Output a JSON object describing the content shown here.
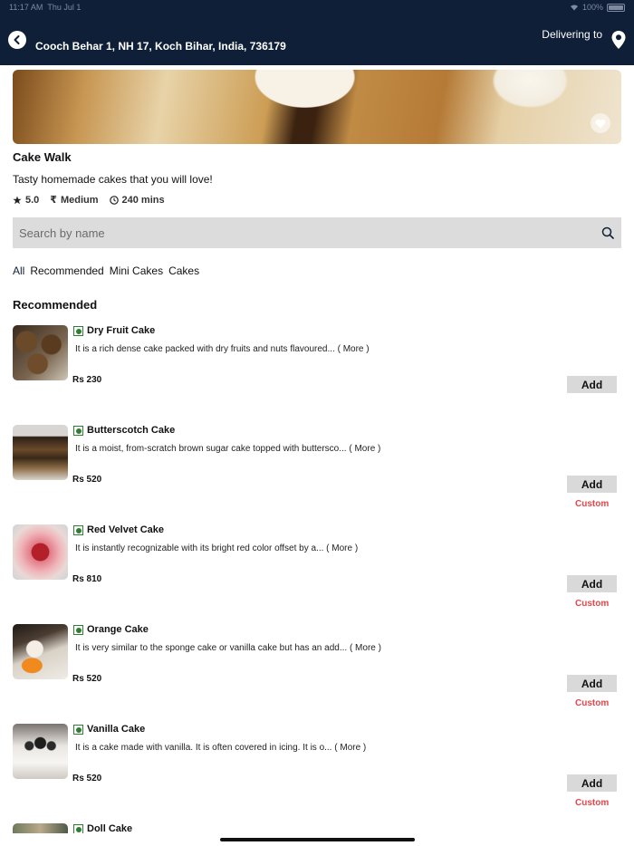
{
  "status_bar": {
    "time": "11:17 AM",
    "date": "Thu Jul 1",
    "battery": "100%"
  },
  "header": {
    "address": "Cooch Behar 1, NH 17, Koch Bihar, India, 736179",
    "delivering_label": "Delivering to"
  },
  "restaurant": {
    "name": "Cake Walk",
    "tagline": "Tasty homemade cakes that you will love!",
    "rating": "5.0",
    "price_range": "Medium",
    "delivery_time": "240 mins"
  },
  "search": {
    "placeholder": "Search by name"
  },
  "tabs": [
    {
      "label": "All"
    },
    {
      "label": "Recommended"
    },
    {
      "label": "Mini Cakes"
    },
    {
      "label": "Cakes"
    }
  ],
  "section_title": "Recommended",
  "more_label": "( More )",
  "add_label": "Add",
  "custom_label": "Custom",
  "items": [
    {
      "name": "Dry Fruit Cake",
      "desc": "It is a rich dense cake packed with dry fruits and nuts flavoured...",
      "price": "Rs 230"
    },
    {
      "name": "Butterscotch Cake",
      "desc": "It is a moist, from-scratch brown sugar cake topped with buttersco...",
      "price": "Rs 520"
    },
    {
      "name": "Red Velvet Cake",
      "desc": "It is instantly recognizable with its bright red color offset by a...",
      "price": "Rs 810"
    },
    {
      "name": "Orange Cake",
      "desc": "It is very similar to the sponge cake or vanilla cake but has an add...",
      "price": "Rs 520"
    },
    {
      "name": "Vanilla Cake",
      "desc": "It is a cake made with vanilla. It is often covered in icing. It is o...",
      "price": "Rs 520"
    },
    {
      "name": "Doll Cake"
    }
  ],
  "colors": {
    "header_bg": "#0f1f38",
    "custom_red": "#e8454a",
    "veg_green": "#2e7d32"
  }
}
